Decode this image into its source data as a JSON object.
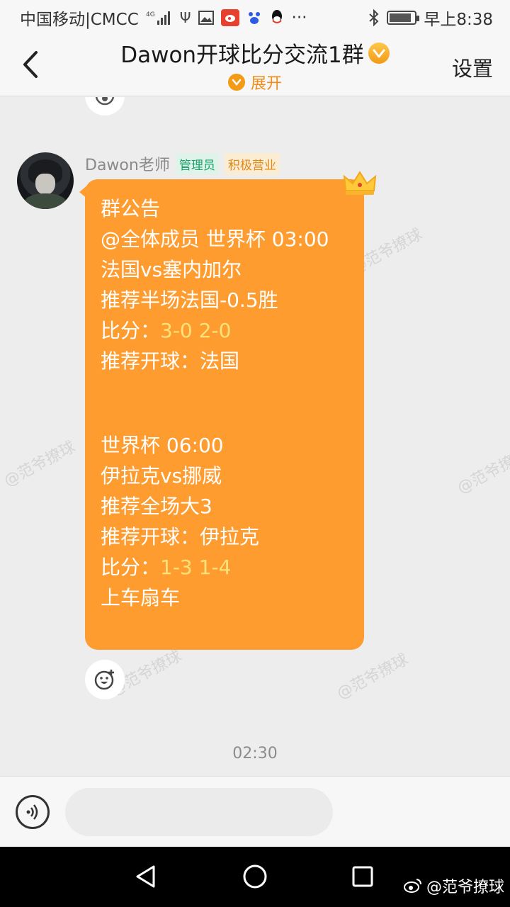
{
  "status_bar": {
    "carrier": "中国移动|CMCC",
    "network": "4G",
    "time": "早上8:38",
    "more": "···"
  },
  "header": {
    "title": "Dawon开球比分交流1群",
    "expand_label": "展开",
    "settings_label": "设置"
  },
  "message": {
    "sender": "Dawon老师",
    "tags": [
      "管理员",
      "积极营业"
    ],
    "lines": [
      {
        "text": "群公告"
      },
      {
        "text": "@全体成员 世界杯 03:00"
      },
      {
        "text": "法国vs塞内加尔"
      },
      {
        "text": "推荐半场法国-0.5胜"
      },
      {
        "label": "比分：",
        "score": "3-0 2-0"
      },
      {
        "text": "推荐开球：法国"
      },
      {
        "text": "世界杯 06:00"
      },
      {
        "text": "伊拉克vs挪威"
      },
      {
        "text": "推荐全场大3"
      },
      {
        "text": "推荐开球：伊拉克"
      },
      {
        "label": "比分：",
        "score": "1-3 1-4"
      },
      {
        "text": "上车扇车"
      }
    ]
  },
  "timestamp": "02:30",
  "watermark": "@范爷撩球",
  "input": {
    "placeholder": ""
  },
  "footer_watermark": "@范爷撩球",
  "colors": {
    "bubble": "#ff9c30",
    "score": "#ffe27a",
    "accent": "#f08c1a"
  }
}
